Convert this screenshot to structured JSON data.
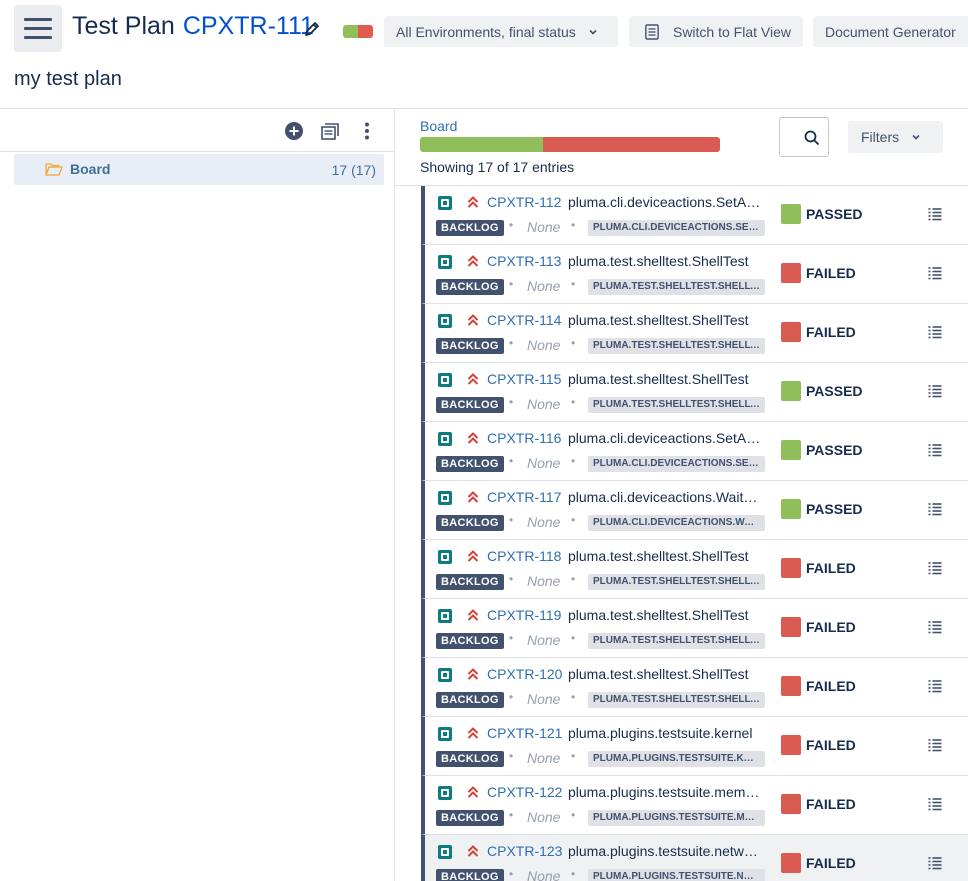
{
  "header": {
    "title": "Test Plan",
    "key": "CPXTR-111",
    "subtitle": "my test plan",
    "env_button": "All Environments, final status",
    "flat_view_button": "Switch to Flat View",
    "doc_generator_button": "Document Generator",
    "status_colors": {
      "passed": "#8fbe5a",
      "failed": "#e05a4e"
    }
  },
  "left": {
    "tree": [
      {
        "label": "Board",
        "count": "17 (17)"
      }
    ]
  },
  "board": {
    "label": "Board",
    "passed_fraction": 0.41,
    "showing": "Showing 17 of 17 entries",
    "filters_label": "Filters"
  },
  "rows": [
    {
      "key": "CPXTR-112",
      "summary": "pluma.cli.deviceactions.SetAttrAction",
      "status_badge": "BACKLOG",
      "none": "None",
      "label": "PLUMA.CLI.DEVICEACTIONS.SETATTRACTION",
      "result": "PASSED",
      "color": "#8fbe5a"
    },
    {
      "key": "CPXTR-113",
      "summary": "pluma.test.shelltest.ShellTest",
      "status_badge": "BACKLOG",
      "none": "None",
      "label": "PLUMA.TEST.SHELLTEST.SHELLTEST",
      "result": "FAILED",
      "color": "#d95b51"
    },
    {
      "key": "CPXTR-114",
      "summary": "pluma.test.shelltest.ShellTest",
      "status_badge": "BACKLOG",
      "none": "None",
      "label": "PLUMA.TEST.SHELLTEST.SHELLTEST",
      "result": "FAILED",
      "color": "#d95b51"
    },
    {
      "key": "CPXTR-115",
      "summary": "pluma.test.shelltest.ShellTest",
      "status_badge": "BACKLOG",
      "none": "None",
      "label": "PLUMA.TEST.SHELLTEST.SHELLTEST",
      "result": "PASSED",
      "color": "#8fbe5a"
    },
    {
      "key": "CPXTR-116",
      "summary": "pluma.cli.deviceactions.SetAttrAction",
      "status_badge": "BACKLOG",
      "none": "None",
      "label": "PLUMA.CLI.DEVICEACTIONS.SETATTRACTION",
      "result": "PASSED",
      "color": "#8fbe5a"
    },
    {
      "key": "CPXTR-117",
      "summary": "pluma.cli.deviceactions.WaitAction",
      "status_badge": "BACKLOG",
      "none": "None",
      "label": "PLUMA.CLI.DEVICEACTIONS.WAITACTION",
      "result": "PASSED",
      "color": "#8fbe5a"
    },
    {
      "key": "CPXTR-118",
      "summary": "pluma.test.shelltest.ShellTest",
      "status_badge": "BACKLOG",
      "none": "None",
      "label": "PLUMA.TEST.SHELLTEST.SHELLTEST",
      "result": "FAILED",
      "color": "#d95b51"
    },
    {
      "key": "CPXTR-119",
      "summary": "pluma.test.shelltest.ShellTest",
      "status_badge": "BACKLOG",
      "none": "None",
      "label": "PLUMA.TEST.SHELLTEST.SHELLTEST",
      "result": "FAILED",
      "color": "#d95b51"
    },
    {
      "key": "CPXTR-120",
      "summary": "pluma.test.shelltest.ShellTest",
      "status_badge": "BACKLOG",
      "none": "None",
      "label": "PLUMA.TEST.SHELLTEST.SHELLTEST",
      "result": "FAILED",
      "color": "#d95b51"
    },
    {
      "key": "CPXTR-121",
      "summary": "pluma.plugins.testsuite.kernel",
      "status_badge": "BACKLOG",
      "none": "None",
      "label": "PLUMA.PLUGINS.TESTSUITE.KERNEL",
      "result": "FAILED",
      "color": "#d95b51"
    },
    {
      "key": "CPXTR-122",
      "summary": "pluma.plugins.testsuite.memory",
      "status_badge": "BACKLOG",
      "none": "None",
      "label": "PLUMA.PLUGINS.TESTSUITE.MEMORY",
      "result": "FAILED",
      "color": "#d95b51"
    },
    {
      "key": "CPXTR-123",
      "summary": "pluma.plugins.testsuite.network",
      "status_badge": "BACKLOG",
      "none": "None",
      "label": "PLUMA.PLUGINS.TESTSUITE.NETWORK",
      "result": "FAILED",
      "color": "#d95b51"
    }
  ]
}
